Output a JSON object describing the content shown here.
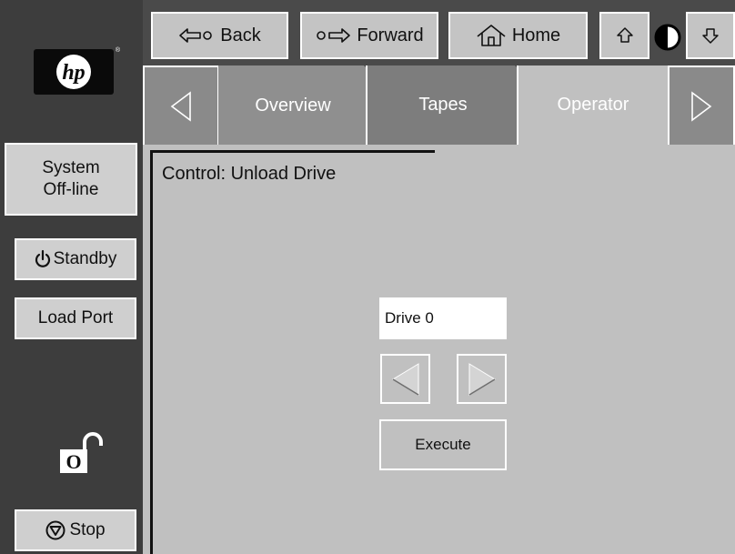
{
  "sidebar": {
    "logo_text": "hp",
    "logo_mark": "®",
    "status_button": {
      "line1": "System",
      "line2": "Off-line"
    },
    "standby_label": "Standby",
    "load_port_label": "Load Port",
    "lock_glyph": "O",
    "stop_label": "Stop"
  },
  "toolbar": {
    "back_label": "Back",
    "forward_label": "Forward",
    "home_label": "Home"
  },
  "tabs": [
    {
      "label": "Overview",
      "active": false
    },
    {
      "label": "Tapes",
      "active": false
    },
    {
      "label": "Operator",
      "active": true
    }
  ],
  "content": {
    "title": "Control: Unload Drive",
    "drive_value": "Drive 0",
    "execute_label": "Execute"
  },
  "colors": {
    "sidebar": "#3d3d3d",
    "toolbar": "#4a4a4a",
    "panel": "#c0c0c0",
    "button": "#c4c4c4"
  }
}
